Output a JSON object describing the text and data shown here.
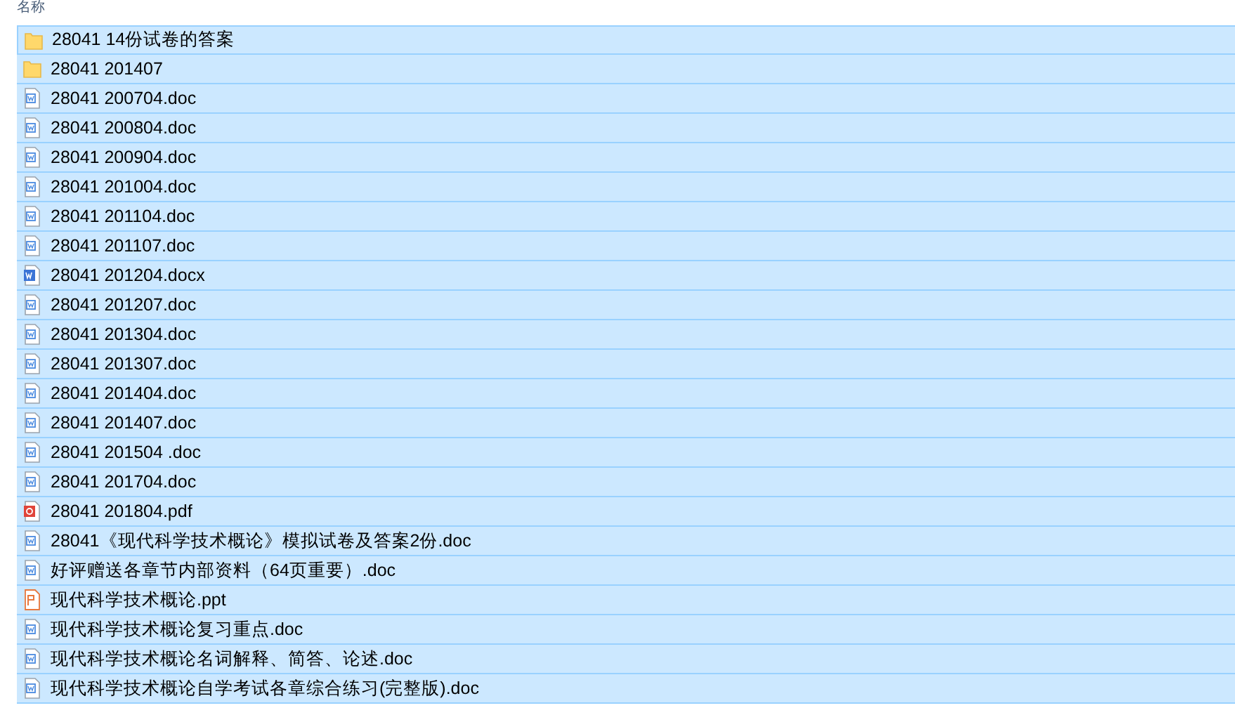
{
  "header": {
    "name_column": "名称"
  },
  "files": [
    {
      "kind": "folder",
      "name": "28041 14份试卷的答案",
      "selected": true
    },
    {
      "kind": "folder",
      "name": "28041 201407",
      "selected": true
    },
    {
      "kind": "doc",
      "name": "28041 200704.doc",
      "selected": true
    },
    {
      "kind": "doc",
      "name": "28041 200804.doc",
      "selected": true
    },
    {
      "kind": "doc",
      "name": "28041 200904.doc",
      "selected": true
    },
    {
      "kind": "doc",
      "name": "28041 201004.doc",
      "selected": true
    },
    {
      "kind": "doc",
      "name": "28041 201104.doc",
      "selected": true
    },
    {
      "kind": "doc",
      "name": "28041 201107.doc",
      "selected": true
    },
    {
      "kind": "docx",
      "name": "28041 201204.docx",
      "selected": true
    },
    {
      "kind": "doc",
      "name": "28041 201207.doc",
      "selected": true
    },
    {
      "kind": "doc",
      "name": "28041 201304.doc",
      "selected": true
    },
    {
      "kind": "doc",
      "name": "28041 201307.doc",
      "selected": true
    },
    {
      "kind": "doc",
      "name": "28041 201404.doc",
      "selected": true
    },
    {
      "kind": "doc",
      "name": "28041 201407.doc",
      "selected": true
    },
    {
      "kind": "doc",
      "name": "28041 201504 .doc",
      "selected": true
    },
    {
      "kind": "doc",
      "name": "28041 201704.doc",
      "selected": true
    },
    {
      "kind": "pdf",
      "name": "28041 201804.pdf",
      "selected": true
    },
    {
      "kind": "doc",
      "name": "28041《现代科学技术概论》模拟试卷及答案2份.doc",
      "selected": true
    },
    {
      "kind": "doc",
      "name": "好评赠送各章节内部资料（64页重要）.doc",
      "selected": true
    },
    {
      "kind": "ppt",
      "name": "现代科学技术概论.ppt",
      "selected": true
    },
    {
      "kind": "doc",
      "name": "现代科学技术概论复习重点.doc",
      "selected": true
    },
    {
      "kind": "doc",
      "name": "现代科学技术概论名词解释、简答、论述.doc",
      "selected": true
    },
    {
      "kind": "doc",
      "name": "现代科学技术概论自学考试各章综合练习(完整版).doc",
      "selected": true
    }
  ]
}
